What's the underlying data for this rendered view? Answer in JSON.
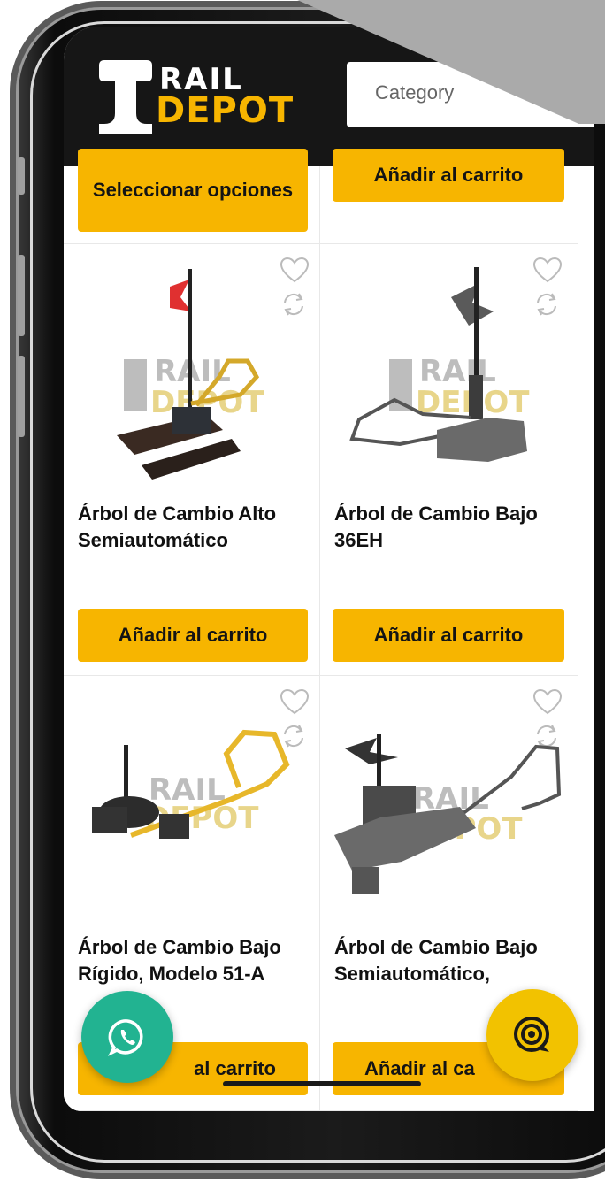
{
  "header": {
    "logo_line1": "RAIL",
    "logo_line2": "DEPOT",
    "category_placeholder": "Category"
  },
  "cards_top": [
    {
      "button": "Seleccionar opciones"
    },
    {
      "button": "Añadir al carrito"
    }
  ],
  "products": [
    {
      "title": "Árbol de Cambio Alto Semiautomático",
      "button": "Añadir al carrito"
    },
    {
      "title": "Árbol de Cambio Bajo 36EH",
      "button": "Añadir al carrito"
    },
    {
      "title": "Árbol de Cambio Bajo Rígido, Modelo 51-A",
      "button": "al carrito"
    },
    {
      "title": "Árbol de Cambio Bajo Semiautomático,",
      "button": "Añadir al ca"
    }
  ],
  "watermark": {
    "line1": "RAIL",
    "line2": "DEPOT"
  },
  "icons": {
    "wishlist": "heart-icon",
    "compare": "refresh-icon",
    "whatsapp": "whatsapp-icon",
    "chat": "chat-bubble-icon"
  },
  "colors": {
    "accent": "#f7b500",
    "whatsapp": "#22b391",
    "chat": "#f2c200",
    "header": "#161616"
  }
}
